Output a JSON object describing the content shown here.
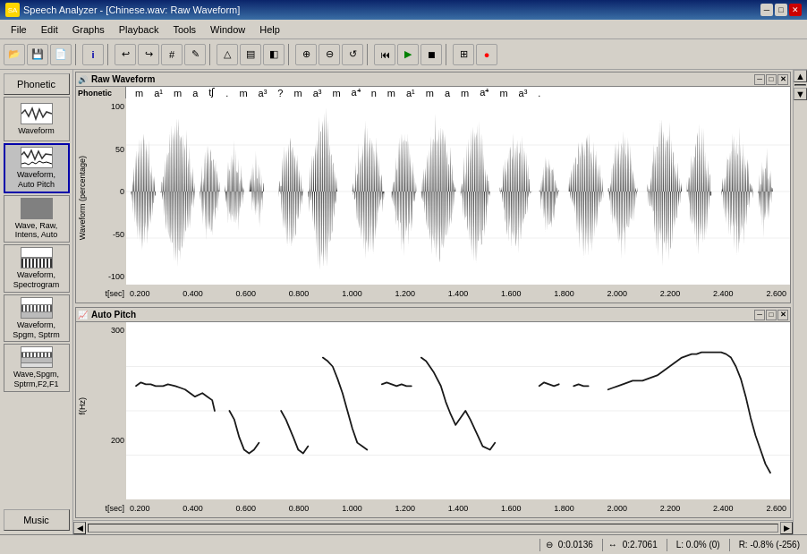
{
  "titlebar": {
    "title": "Speech Analyzer - [Chinese.wav: Raw Waveform]",
    "icon": "SA",
    "min_btn": "─",
    "max_btn": "□",
    "close_btn": "✕"
  },
  "menubar": {
    "items": [
      "File",
      "Edit",
      "Graphs",
      "Playback",
      "Tools",
      "Window",
      "Help"
    ]
  },
  "toolbar": {
    "buttons": [
      {
        "label": "📂",
        "name": "open"
      },
      {
        "label": "💾",
        "name": "save"
      },
      {
        "label": "📄",
        "name": "new"
      },
      {
        "sep": true
      },
      {
        "label": "ℹ",
        "name": "info"
      },
      {
        "sep": true
      },
      {
        "label": "↩",
        "name": "undo"
      },
      {
        "label": "↪",
        "name": "redo"
      },
      {
        "label": "#",
        "name": "hash"
      },
      {
        "label": "✎",
        "name": "edit"
      },
      {
        "sep": true
      },
      {
        "label": "△",
        "name": "triangle"
      },
      {
        "label": "▤",
        "name": "grid1"
      },
      {
        "label": "◧",
        "name": "grid2"
      },
      {
        "sep": true
      },
      {
        "label": "⊕",
        "name": "zoom-in"
      },
      {
        "label": "⊖",
        "name": "zoom-out"
      },
      {
        "label": "↺",
        "name": "loop"
      },
      {
        "sep": true
      },
      {
        "label": "⏮",
        "name": "prev"
      },
      {
        "label": "▶",
        "name": "play"
      },
      {
        "label": "⏹",
        "name": "stop"
      },
      {
        "sep": true
      },
      {
        "label": "⊞",
        "name": "grid3"
      },
      {
        "label": "🔴",
        "name": "record"
      }
    ]
  },
  "sidebar": {
    "phonetic_btn": "Phonetic",
    "items": [
      {
        "label": "Waveform",
        "name": "waveform"
      },
      {
        "label": "Waveform,\nAuto Pitch",
        "name": "waveform-auto-pitch"
      },
      {
        "label": "Wave, Raw,\nIntens, Auto",
        "name": "wave-raw-intens-auto"
      },
      {
        "label": "Waveform,\nSpectrogram",
        "name": "waveform-spectrogram"
      },
      {
        "label": "Waveform,\nSpgm, Sptrm",
        "name": "waveform-spgm-sptrm"
      },
      {
        "label": "Wave,Spgm,\nSptrm,F2,F1",
        "name": "wave-spgm-sptrm-f2-f1"
      }
    ],
    "music_btn": "Music"
  },
  "raw_waveform_panel": {
    "title": "Raw Waveform",
    "phonetic_label": "Phonetic",
    "phonetic_items": [
      "m",
      "a¹",
      "m",
      "a",
      "tʃ",
      ".",
      "m",
      "a³",
      "?",
      "m",
      "a³",
      "m",
      "a⁴",
      "n",
      "m",
      "a¹",
      "m",
      "a",
      "m",
      "a⁴",
      "m",
      "a³",
      "."
    ],
    "y_label": "Waveform (percentage)",
    "y_ticks": [
      "100",
      "50",
      "0",
      "-50",
      "-100"
    ],
    "x_label": "t[sec]",
    "x_ticks": [
      "0.200",
      "0.400",
      "0.600",
      "0.800",
      "1.000",
      "1.200",
      "1.400",
      "1.600",
      "1.800",
      "2.000",
      "2.200",
      "2.400",
      "2.600"
    ]
  },
  "auto_pitch_panel": {
    "title": "Auto Pitch",
    "y_label": "f(Hz)",
    "y_ticks": [
      "300",
      "200"
    ],
    "x_label": "t[sec]",
    "x_ticks": [
      "0.200",
      "0.400",
      "0.600",
      "0.800",
      "1.000",
      "1.200",
      "1.400",
      "1.600",
      "1.800",
      "2.000",
      "2.200",
      "2.400",
      "2.600"
    ]
  },
  "statusbar": {
    "cursor_label": "⊖",
    "cursor_time": "0:0.0136",
    "selection_label": "↔",
    "selection_time": "0:2.7061",
    "left_label": "L: 0.0% (0)",
    "right_label": "R: -0.8% (-256)"
  }
}
